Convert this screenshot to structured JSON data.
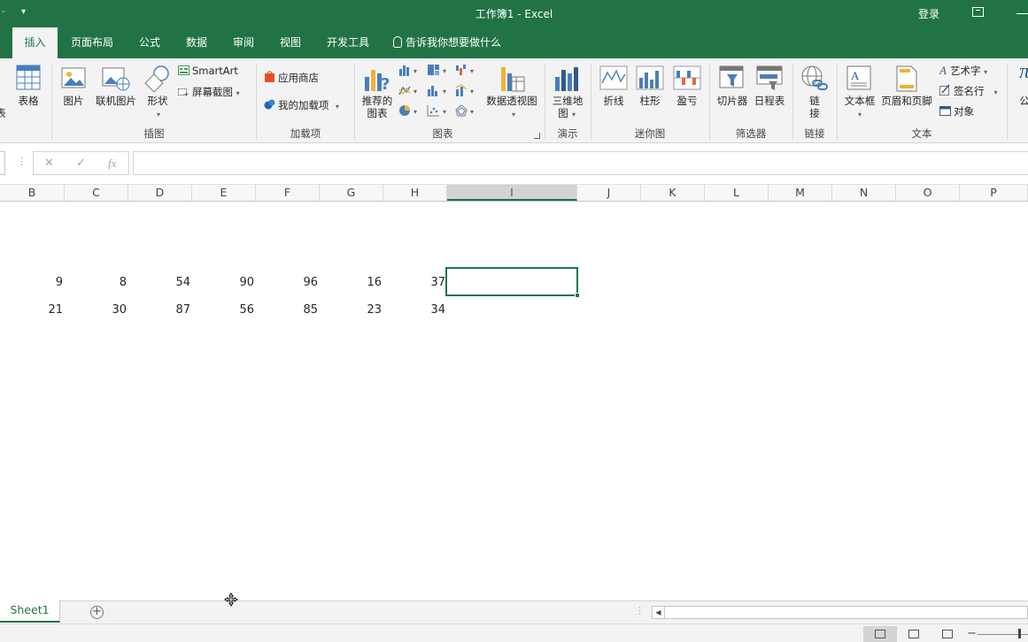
{
  "app": {
    "title": "工作簿1  -  Excel",
    "login_label": "登录"
  },
  "tabs": [
    {
      "label": "插入"
    },
    {
      "label": "页面布局"
    },
    {
      "label": "公式"
    },
    {
      "label": "数据"
    },
    {
      "label": "审阅"
    },
    {
      "label": "视图"
    },
    {
      "label": "开发工具"
    }
  ],
  "tell_me": "告诉我你想要做什么",
  "ribbon": {
    "tables": {
      "table_label": "表格",
      "partial_label": "表"
    },
    "illustrations": {
      "group_label": "插图",
      "picture": "图片",
      "online_picture": "联机图片",
      "shapes": "形状",
      "smartart": "SmartArt",
      "screenshot": "屏幕截图"
    },
    "addins": {
      "group_label": "加载项",
      "store": "应用商店",
      "my_addins": "我的加载项"
    },
    "charts": {
      "group_label": "图表",
      "recommended_line1": "推荐的",
      "recommended_line2": "图表",
      "pivot_chart": "数据透视图"
    },
    "tours": {
      "group_label": "演示",
      "map_line1": "三维地",
      "map_line2": "图"
    },
    "sparklines": {
      "group_label": "迷你图",
      "line": "折线",
      "column": "柱形",
      "win_loss": "盈亏"
    },
    "filters": {
      "group_label": "筛选器",
      "slicer": "切片器",
      "timeline": "日程表"
    },
    "links": {
      "group_label": "链接",
      "link_line1": "链",
      "link_line2": "接"
    },
    "text": {
      "group_label": "文本",
      "textbox": "文本框",
      "header_footer": "页眉和页脚",
      "wordart": "艺术字",
      "signature": "签名行",
      "object": "对象",
      "partial": "公"
    }
  },
  "formula_bar": {
    "cancel": "✕",
    "enter": "✓",
    "fx": "fx",
    "value": ""
  },
  "columns": [
    "B",
    "C",
    "D",
    "E",
    "F",
    "G",
    "H",
    "I",
    "J",
    "K",
    "L",
    "M",
    "N",
    "O",
    "P"
  ],
  "selected_column": "I",
  "rows": [
    [
      "9",
      "8",
      "54",
      "90",
      "96",
      "16",
      "37"
    ],
    [
      "21",
      "30",
      "87",
      "56",
      "85",
      "23",
      "34"
    ]
  ],
  "sheets": [
    {
      "label": "Sheet1"
    }
  ],
  "add_sheet": "+",
  "colors": {
    "accent": "#217346",
    "ribbon_bg": "#f3f3f3"
  }
}
